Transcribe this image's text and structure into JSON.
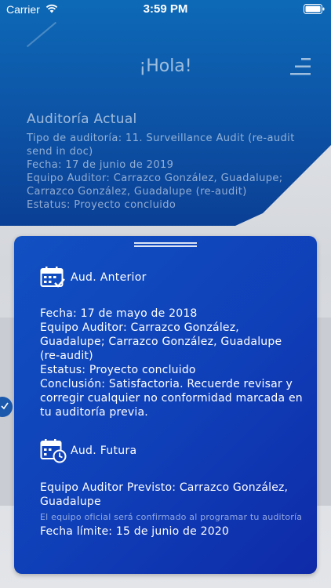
{
  "status_bar": {
    "carrier": "Carrier",
    "time": "3:59 PM",
    "wifi_icon": "wifi-icon",
    "battery_icon": "battery-icon"
  },
  "header": {
    "greeting": "¡Hola!",
    "menu_icon": "menu-icon"
  },
  "current_audit": {
    "title": "Auditoría Actual",
    "type_line": "Tipo de auditoría: 11. Surveillance Audit (re-audit send in doc)",
    "date_line": "Fecha: 17 de junio de 2019",
    "team_line": "Equipo Auditor: Carrazco González, Guadalupe; Carrazco González, Guadalupe (re-audit)",
    "status_line": "Estatus: Proyecto concluido"
  },
  "previous_audit": {
    "title": "Aud. Anterior",
    "icon": "calendar-check-icon",
    "date_line": "Fecha: 17 de mayo de 2018",
    "team_line": "Equipo Auditor: Carrazco González, Guadalupe; Carrazco González, Guadalupe (re-audit)",
    "status_line": "Estatus: Proyecto concluido",
    "conclusion_line": "Conclusión: Satisfactoria. Recuerde revisar y corregir cualquier no conformidad marcada en tu auditoría previa."
  },
  "future_audit": {
    "title": "Aud. Futura",
    "icon": "calendar-clock-icon",
    "team_line": "Equipo Auditor Previsto: Carrazco González, Guadalupe",
    "note": "El equipo oficial será confirmado al programar tu auditoría",
    "deadline_line": "Fecha límite: 15 de junio de 2020"
  },
  "colors": {
    "header_blue": "#0d56a8",
    "card_blue": "#0f3fb8",
    "background_gray": "#d8dbe0"
  }
}
